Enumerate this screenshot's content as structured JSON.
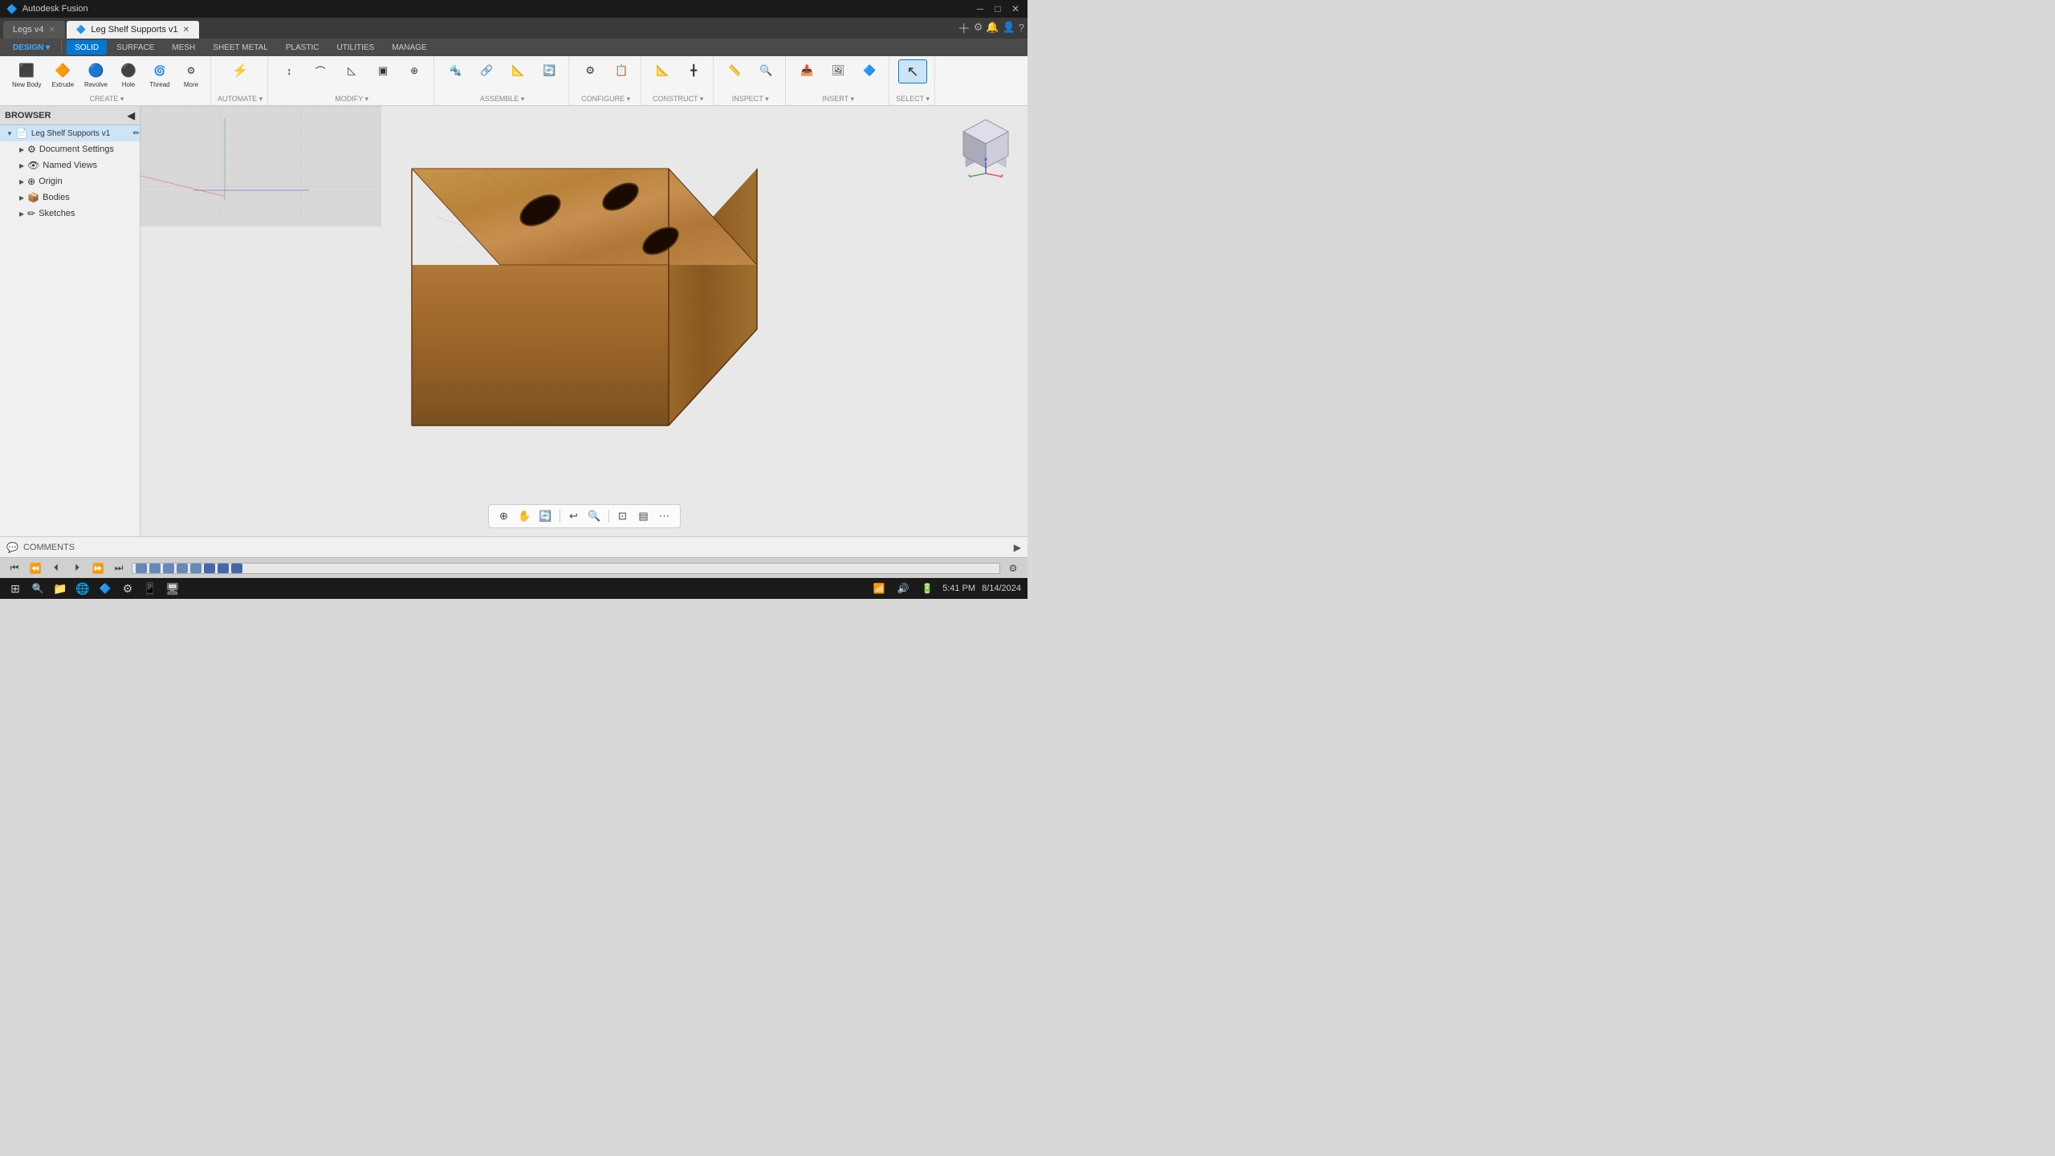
{
  "app": {
    "title": "Autodesk Fusion",
    "icon": "🔷"
  },
  "window_controls": {
    "minimize": "─",
    "maximize": "□",
    "close": "✕"
  },
  "tabs": [
    {
      "label": "Legs v4",
      "active": true,
      "closeable": true
    },
    {
      "label": "Leg Shelf Supports v1",
      "active": false,
      "closeable": true
    }
  ],
  "mode_tabs": [
    {
      "label": "SOLID",
      "active": true
    },
    {
      "label": "SURFACE",
      "active": false
    },
    {
      "label": "MESH",
      "active": false
    },
    {
      "label": "SHEET METAL",
      "active": false
    },
    {
      "label": "PLASTIC",
      "active": false
    },
    {
      "label": "UTILITIES",
      "active": false
    },
    {
      "label": "MANAGE",
      "active": false
    }
  ],
  "ribbon_groups": [
    {
      "title": "CREATE ▾",
      "buttons": [
        "🔲",
        "🔶",
        "🔵",
        "◾",
        "⬜",
        "⚙"
      ]
    },
    {
      "title": "AUTOMATE ▾",
      "buttons": [
        "⚡"
      ]
    },
    {
      "title": "MODIFY ▾",
      "buttons": [
        "✏",
        "🔧",
        "📐",
        "➕",
        "📏"
      ]
    },
    {
      "title": "ASSEMBLE ▾",
      "buttons": [
        "🔩",
        "📦",
        "🔗",
        "🔄"
      ]
    },
    {
      "title": "CONFIGURE ▾",
      "buttons": [
        "⚙",
        "📋"
      ]
    },
    {
      "title": "CONSTRUCT ▾",
      "buttons": [
        "📐",
        "🔷"
      ]
    },
    {
      "title": "INSPECT ▾",
      "buttons": [
        "🔍",
        "📏"
      ]
    },
    {
      "title": "INSERT ▾",
      "buttons": [
        "📥",
        "🖼",
        "🔷"
      ]
    },
    {
      "title": "SELECT ▾",
      "buttons": [
        "↖"
      ],
      "active": true
    }
  ],
  "browser": {
    "title": "BROWSER",
    "items": [
      {
        "label": "Leg Shelf Supports v1",
        "level": 0,
        "has_arrow": true,
        "selected": true,
        "icon": "📄"
      },
      {
        "label": "Document Settings",
        "level": 1,
        "has_arrow": true,
        "icon": "⚙"
      },
      {
        "label": "Named Views",
        "level": 1,
        "has_arrow": true,
        "icon": "👁"
      },
      {
        "label": "Origin",
        "level": 1,
        "has_arrow": true,
        "icon": "📐"
      },
      {
        "label": "Bodies",
        "level": 1,
        "has_arrow": true,
        "icon": "📦"
      },
      {
        "label": "Sketches",
        "level": 1,
        "has_arrow": true,
        "icon": "✏"
      }
    ]
  },
  "viewport": {
    "background_color": "#c8c8c8"
  },
  "bottom_toolbar": {
    "buttons": [
      "⊕",
      "🤚",
      "🔄",
      "↺",
      "🔍",
      "⊡",
      "▤",
      "⋯"
    ]
  },
  "comments": {
    "label": "COMMENTS",
    "icon": "💬"
  },
  "timeline": {
    "play_controls": [
      "⏮",
      "⏪",
      "⏴",
      "⏵",
      "⏩",
      "⏭"
    ],
    "steps": 8
  },
  "taskbar": {
    "icons": [
      "🪟",
      "🔍",
      "📁",
      "⚙",
      "🌐",
      "🔔",
      "📧",
      "🖥",
      "⚡",
      "📱",
      "🔊"
    ],
    "time": "5:41 PM",
    "date": "8/14/2024"
  },
  "design_mode": "DESIGN ▾"
}
